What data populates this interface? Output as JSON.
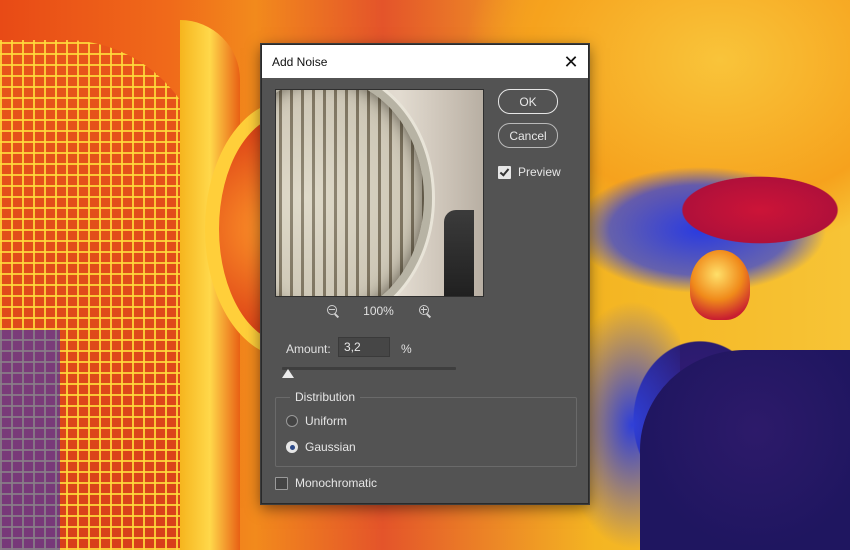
{
  "dialog": {
    "title": "Add Noise",
    "close_glyph": "✕",
    "ok_label": "OK",
    "cancel_label": "Cancel",
    "preview_label": "Preview",
    "preview_checked": true,
    "zoom_level": "100%",
    "amount_label": "Amount:",
    "amount_value": "3,2",
    "amount_unit": "%",
    "distribution_legend": "Distribution",
    "distribution_options": [
      {
        "label": "Uniform",
        "selected": false
      },
      {
        "label": "Gaussian",
        "selected": true
      }
    ],
    "monochromatic_label": "Monochromatic",
    "monochromatic_checked": false
  },
  "icons": {
    "zoom_out": "zoom-out-icon",
    "zoom_in": "zoom-in-icon",
    "close": "close-icon"
  }
}
